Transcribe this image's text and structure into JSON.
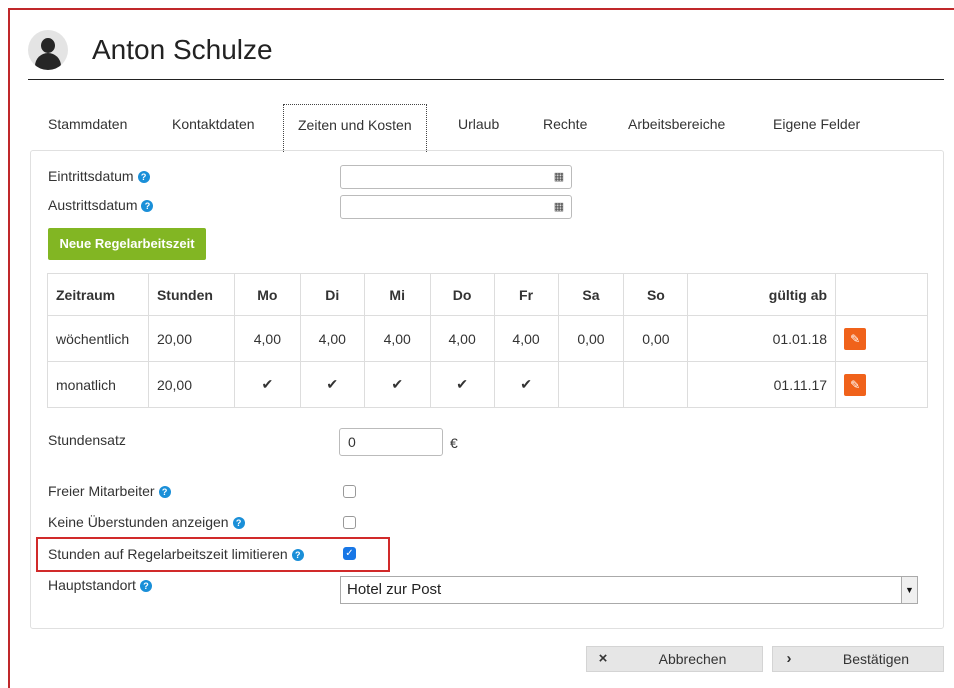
{
  "header": {
    "title": "Anton Schulze"
  },
  "tabs": [
    {
      "label": "Stammdaten"
    },
    {
      "label": "Kontaktdaten"
    },
    {
      "label": "Zeiten und Kosten",
      "active": true
    },
    {
      "label": "Urlaub"
    },
    {
      "label": "Rechte"
    },
    {
      "label": "Arbeitsbereiche"
    },
    {
      "label": "Eigene Felder"
    }
  ],
  "form": {
    "eintrittsdatum_label": "Eintrittsdatum",
    "eintrittsdatum_value": "",
    "austrittsdatum_label": "Austrittsdatum",
    "austrittsdatum_value": "",
    "calendar_glyph": "▦",
    "new_button": "Neue Regelarbeitszeit",
    "stundensatz_label": "Stundensatz",
    "stundensatz_value": "0",
    "currency": "€",
    "freier_label": "Freier Mitarbeiter",
    "freier_checked": false,
    "keine_label": "Keine Überstunden anzeigen",
    "keine_checked": false,
    "limit_label": "Stunden auf Regelarbeitszeit limitieren",
    "limit_checked": true,
    "hauptstandort_label": "Hauptstandort",
    "hauptstandort_value": "Hotel zur Post"
  },
  "table": {
    "headers": [
      "Zeitraum",
      "Stunden",
      "Mo",
      "Di",
      "Mi",
      "Do",
      "Fr",
      "Sa",
      "So",
      "gültig ab",
      ""
    ],
    "rows": [
      [
        "wöchentlich",
        "20,00",
        "4,00",
        "4,00",
        "4,00",
        "4,00",
        "4,00",
        "0,00",
        "0,00",
        "01.01.18"
      ],
      [
        "monatlich",
        "20,00",
        "✔",
        "✔",
        "✔",
        "✔",
        "✔",
        "",
        "",
        "01.11.17"
      ]
    ],
    "edit_glyph": "✎"
  },
  "footer": {
    "cancel_label": "Abbrechen",
    "cancel_icon": "×",
    "confirm_label": "Bestätigen",
    "confirm_icon": "›"
  },
  "colors": {
    "accent_green": "#82b623",
    "edit_orange": "#f0621a",
    "help_blue": "#1a8fd8",
    "highlight_red": "#d12a2a",
    "checkbox_blue": "#1877e6"
  }
}
